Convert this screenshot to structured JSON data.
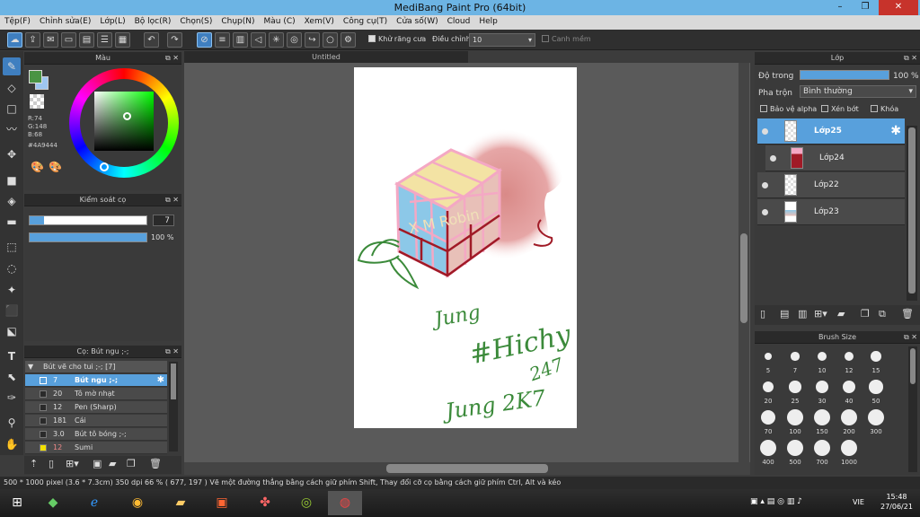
{
  "window": {
    "title": "MediBang Paint Pro (64bit)",
    "minimize": "–",
    "maximize": "❐",
    "close": "✕"
  },
  "menu": [
    "Tệp(F)",
    "Chỉnh sửa(E)",
    "Lớp(L)",
    "Bộ lọc(R)",
    "Chọn(S)",
    "Chụp(N)",
    "Màu (C)",
    "Xem(V)",
    "Công cụ(T)",
    "Cửa số(W)",
    "Cloud",
    "Help"
  ],
  "toolbar": {
    "antialias_label": "Khử răng cưa",
    "adjust_label": "Điều chỉnh",
    "adjust_value": "10",
    "stabilizer_label": "Canh mềm"
  },
  "color_panel": {
    "title": "Màu",
    "r": "R:74",
    "g": "G:148",
    "b": "B:68",
    "hex": "#4A9444",
    "current_color": "#4A9444"
  },
  "brush_control": {
    "title": "Kiểm soát cọ",
    "size": "7",
    "opacity": "100 %",
    "opacity_level": 1.0
  },
  "brush_panel": {
    "title": "Cọ: Bút ngu ;-;",
    "group": "Bút vẽ cho tui ;-; [7]",
    "items": [
      {
        "size": "7",
        "name": "Bút ngu ;-;"
      },
      {
        "size": "20",
        "name": "Tô mờ nhạt"
      },
      {
        "size": "12",
        "name": "Pen (Sharp)"
      },
      {
        "size": "181",
        "name": "Cái"
      },
      {
        "size": "3.0",
        "name": "Bút tô bóng ;-;"
      },
      {
        "size": "12",
        "name": "Sumi"
      }
    ]
  },
  "document": {
    "tab": "Untitled"
  },
  "canvas_text": {
    "cube_text": "X M Robin",
    "line1": "Jung",
    "line2": "#Hichy",
    "line3": "Jung 2K7",
    "line4": "247"
  },
  "layer_panel": {
    "title": "Lớp",
    "opacity_label": "Độ trong",
    "opacity_value": "100 %",
    "opacity_level": 1.0,
    "blend_label": "Pha trộn",
    "blend_value": "Bình thường",
    "protect_alpha": "Bảo vệ alpha",
    "clipping": "Xén bớt",
    "lock": "Khóa",
    "layers": [
      "Lớp25",
      "Lớp24",
      "Lớp22",
      "Lớp23"
    ]
  },
  "brush_size": {
    "title": "Brush Size",
    "sizes": [
      "5",
      "7",
      "10",
      "12",
      "15",
      "20",
      "25",
      "30",
      "40",
      "50",
      "70",
      "100",
      "150",
      "200",
      "300",
      "400",
      "500",
      "700",
      "1000"
    ]
  },
  "status": "500 * 1000 pixel   (3.6 * 7.3cm)   350 dpi   66 %   ( 677, 197 )   Vẽ một đường thẳng bằng cách giữ phím Shift, Thay đổi cỡ cọ bằng cách giữ phím Ctrl, Alt và kéo",
  "tray": {
    "lang": "VIE",
    "time": "15:48",
    "date": "27/06/21"
  },
  "colors": {
    "accent": "#58a0dc",
    "titlebar": "#6cb4e4",
    "close": "#c7332b"
  }
}
